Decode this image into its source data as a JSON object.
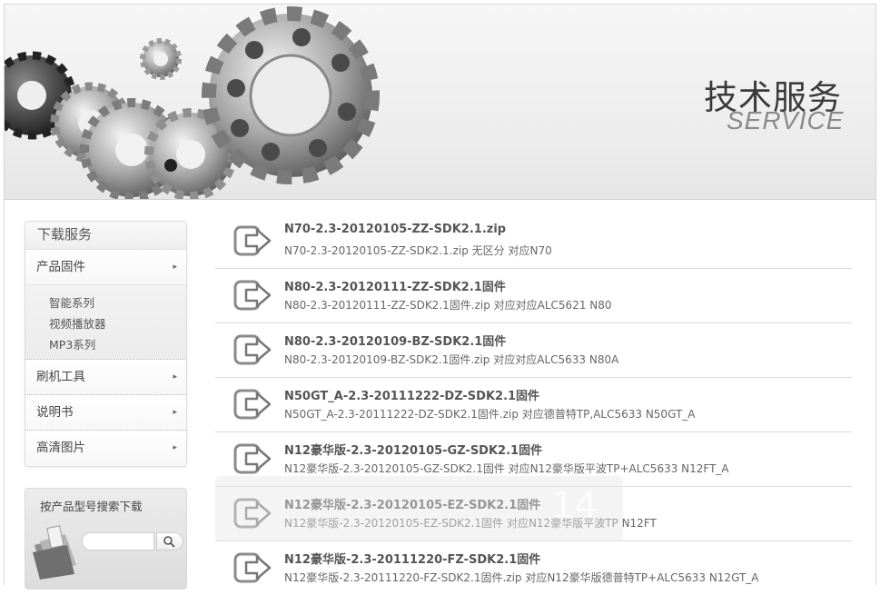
{
  "banner": {
    "title": "技术服务",
    "subtitle": "SERVICE"
  },
  "sidebar": {
    "heading": "下载服务",
    "items": [
      {
        "label": "产品固件",
        "arrow": "▸"
      },
      {
        "label": "刷机工具",
        "arrow": "▸"
      },
      {
        "label": "说明书",
        "arrow": "▸"
      },
      {
        "label": "高清图片",
        "arrow": "▸"
      }
    ],
    "submenu": [
      "智能系列",
      "视频播放器",
      "MP3系列"
    ]
  },
  "search": {
    "title": "按产品型号搜索下载",
    "placeholder": "",
    "button_icon": "search-icon"
  },
  "downloads": [
    {
      "title": "N70-2.3-20120105-ZZ-SDK2.1.zip",
      "desc": "N70-2.3-20120105-ZZ-SDK2.1.zip 无区分 对应N70"
    },
    {
      "title": "N80-2.3-20120111-ZZ-SDK2.1固件",
      "desc": "N80-2.3-20120111-ZZ-SDK2.1固件.zip 对应对应ALC5621 N80"
    },
    {
      "title": "N80-2.3-20120109-BZ-SDK2.1固件",
      "desc": "N80-2.3-20120109-BZ-SDK2.1固件.zip 对应对应ALC5633 N80A"
    },
    {
      "title": "N50GT_A-2.3-20111222-DZ-SDK2.1固件",
      "desc": "N50GT_A-2.3-20111222-DZ-SDK2.1固件.zip 对应德普特TP,ALC5633 N50GT_A"
    },
    {
      "title": "N12豪华版-2.3-20120105-GZ-SDK2.1固件",
      "desc": "N12豪华版-2.3-20120105-GZ-SDK2.1固件 对应N12豪华版平波TP+ALC5633 N12FT_A"
    },
    {
      "title": "N12豪华版-2.3-20120105-EZ-SDK2.1固件",
      "desc": "N12豪华版-2.3-20120105-EZ-SDK2.1固件 对应N12豪华版平波TP N12FT"
    },
    {
      "title": "N12豪华版-2.3-20111220-FZ-SDK2.1固件",
      "desc": "N12豪华版-2.3-20111220-FZ-SDK2.1固件.zip 对应N12豪华版德普特TP+ALC5633 N12GT_A"
    }
  ],
  "watermark_text": "14",
  "colors": {
    "accent": "#555555",
    "divider": "#dadada"
  }
}
